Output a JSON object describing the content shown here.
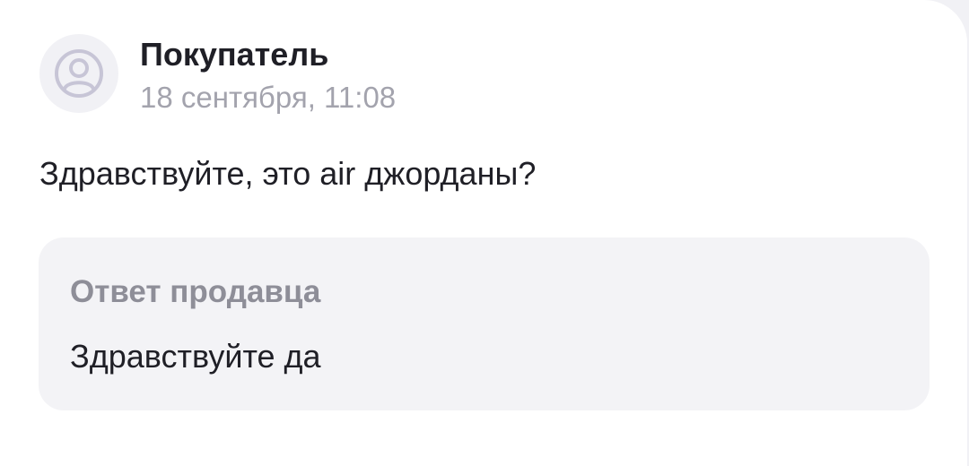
{
  "review": {
    "author": "Покупатель",
    "date": "18 сентября, 11:08",
    "text": "Здравствуйте, это air джорданы?",
    "avatar_icon": "user-avatar-icon"
  },
  "seller_reply": {
    "title": "Ответ продавца",
    "text": "Здравствуйте да"
  },
  "colors": {
    "card_background": "#ffffff",
    "page_background": "#f1f1f5",
    "reply_background": "#f3f3f6",
    "primary_text": "#1f1f26",
    "secondary_text": "#a3a3ad",
    "reply_title_text": "#8e8e98",
    "avatar_icon": "#c7c5d6"
  }
}
